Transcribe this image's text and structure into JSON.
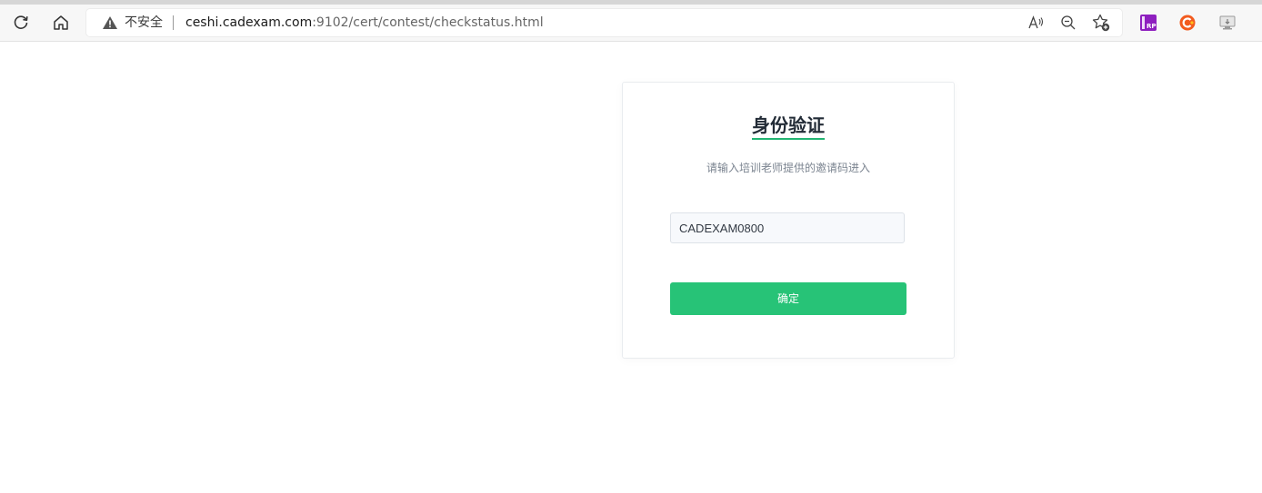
{
  "browser": {
    "security_label": "不安全",
    "url_host": "ceshi.cadexam.com",
    "url_rest": ":9102/cert/contest/checkstatus.html",
    "icons": {
      "reload": "reload-icon",
      "home": "home-icon",
      "warning": "warning-icon",
      "read_aloud": "read-aloud-icon",
      "zoom_out": "zoom-out-icon",
      "favorites": "add-favorite-icon",
      "ext_rp": "axure-rp-extension-icon",
      "ext_c": "c-extension-icon",
      "ext_monitor": "monitor-extension-icon"
    },
    "ext_rp_text": "RP"
  },
  "card": {
    "title": "身份验证",
    "subtitle": "请输入培训老师提供的邀请码进入",
    "code_input_value": "CADEXAM0800",
    "confirm_label": "确定"
  },
  "colors": {
    "accent": "#27c377",
    "title_underline": "#23b573",
    "title_text": "#222b36",
    "subtitle_text": "#7b8490"
  }
}
